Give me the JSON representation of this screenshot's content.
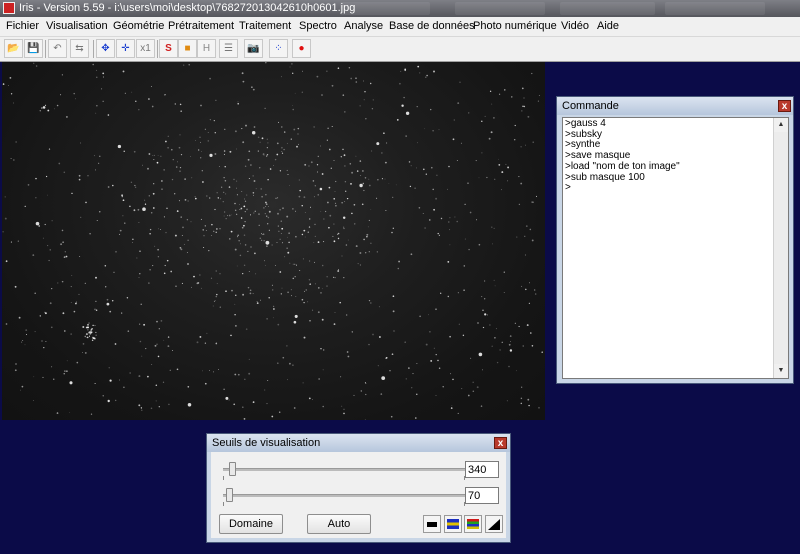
{
  "window": {
    "title": "Iris - Version 5.59 - i:\\users\\moi\\desktop\\768272013042610h0601.jpg"
  },
  "menu": [
    "Fichier",
    "Visualisation",
    "Géométrie",
    "Prétraitement",
    "Traitement",
    "Spectro",
    "Analyse",
    "Base de données",
    "Photo numérique",
    "Vidéo",
    "Aide"
  ],
  "toolbar": [
    {
      "name": "open-icon",
      "glyph": "📂"
    },
    {
      "name": "save-icon",
      "glyph": "💾"
    },
    {
      "name": "undo-icon",
      "glyph": "↶"
    },
    {
      "name": "adjust-icon",
      "glyph": "⇆"
    },
    {
      "name": "move-icon",
      "glyph": "✥"
    },
    {
      "name": "cross-icon",
      "glyph": "✛"
    },
    {
      "name": "zoom-x1-icon",
      "glyph": "x1"
    },
    {
      "name": "slice-icon",
      "glyph": "S"
    },
    {
      "name": "frame-icon",
      "glyph": "■"
    },
    {
      "name": "header-icon",
      "glyph": "H"
    },
    {
      "name": "list-icon",
      "glyph": "☰"
    },
    {
      "name": "camera-icon",
      "glyph": "📷"
    },
    {
      "name": "dots-icon",
      "glyph": "⁘"
    },
    {
      "name": "point-icon",
      "glyph": "●"
    }
  ],
  "command": {
    "title": "Commande",
    "close": "x",
    "lines": [
      ">gauss 4",
      ">subsky",
      ">synthe",
      ">save masque",
      ">load \"nom de ton image\"",
      ">sub masque 100",
      ">"
    ]
  },
  "seuils": {
    "title": "Seuils de visualisation",
    "close": "x",
    "high_value": "340",
    "low_value": "70",
    "domaine_label": "Domaine",
    "auto_label": "Auto"
  },
  "colors": {
    "desktop_bg": "#0b0b48",
    "window_frame": "#c9d6e6"
  }
}
